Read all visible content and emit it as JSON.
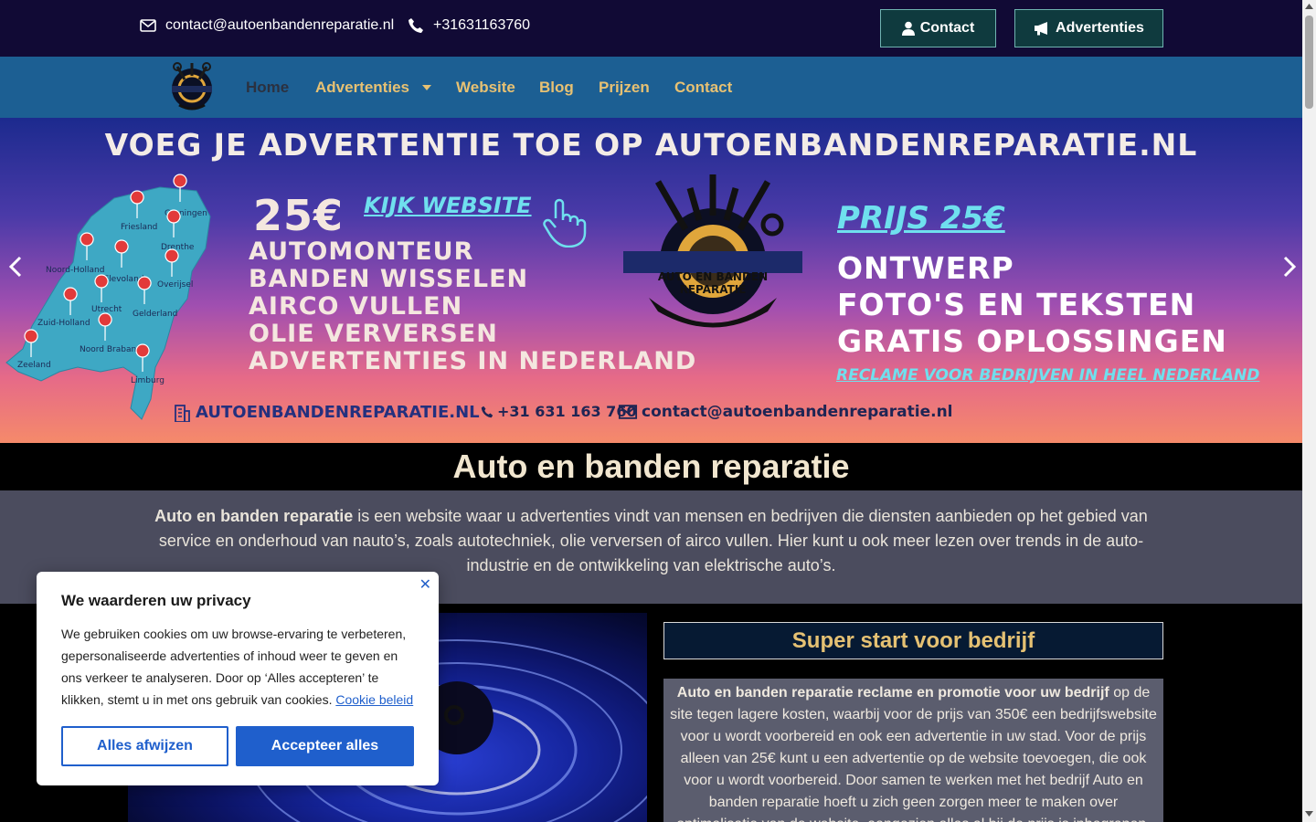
{
  "topbar": {
    "email": "contact@autoenbandenreparatie.nl",
    "phone": "+31631163760",
    "contact_button": "Contact",
    "ads_button": "Advertenties"
  },
  "nav": {
    "items": [
      "Home",
      "Advertenties",
      "Website",
      "Blog",
      "Prijzen",
      "Contact"
    ]
  },
  "hero": {
    "headline": "VOEG JE ADVERTENTIE TOE OP AUTOENBANDENREPARATIE.NL",
    "price_left": "25€",
    "kijk_website": "KIJK WEBSITE",
    "services": [
      "AUTOMONTEUR",
      "BANDEN WISSELEN",
      "AIRCO VULLEN",
      "OLIE VERVERSEN",
      "ADVERTENTIES IN NEDERLAND"
    ],
    "logo_text": "AUTO EN BANDEN REPARATIE",
    "prijs": "PRIJS 25€",
    "offers": [
      "ONTWERP",
      "FOTO'S EN TEKSTEN",
      "GRATIS OPLOSSINGEN"
    ],
    "reclame": "RECLAME VOOR BEDRIJVEN IN HEEL NEDERLAND",
    "bottom_site": "AUTOENBANDENREPARATIE.NL",
    "bottom_phone": "+31 631 163 760",
    "bottom_email": "contact@autoenbandenreparatie.nl",
    "provinces": [
      "Groningen",
      "Friesland",
      "Drenthe",
      "Noord-Holland",
      "Flevoland",
      "Overijsel",
      "Utrecht",
      "Gelderland",
      "Zuid-Holland",
      "Noord Brabant",
      "Zeeland",
      "Limburg"
    ]
  },
  "main": {
    "title": "Auto en banden reparatie",
    "intro_bold": "Auto en banden reparatie",
    "intro_rest": " is een website waar u advertenties vindt van mensen en bedrijven die diensten aanbieden op het gebied van service en onderhoud van nauto’s, zoals autotechniek, olie verversen of airco vullen. Hier kunt u ook meer lezen over trends in de auto-industrie en de ontwikkeling van elektrische auto’s.",
    "super_title": "Super start voor bedrijf",
    "super_bold": "Auto en banden reparatie reclame en promotie voor uw bedrijf",
    "super_rest": " op de site tegen lagere kosten, waarbij voor de prijs van 350€ een bedrijfswebsite voor u wordt voorbereid en ook een advertentie in uw stad. Voor de prijs alleen van 25€ kunt u een advertentie op de website toevoegen, die ook voor u wordt voorbereid. Door samen te werken met het bedrijf Auto en banden reparatie hoeft u zich geen zorgen meer te maken over optimalisatie van de website, aangezien alles al bij de prijs is inbegrepen. Als u echter denkt aan"
  },
  "cookie": {
    "title": "We waarderen uw privacy",
    "body": "We gebruiken cookies om uw browse-ervaring te verbeteren, gepersonaliseerde advertenties of inhoud weer te geven en ons verkeer te analyseren. Door op ‘Alles accepteren’ te klikken, stemt u in met ons gebruik van cookies. ",
    "policy_link": "Cookie beleid",
    "reject": "Alles afwijzen",
    "accept": "Accepteer alles"
  },
  "colors": {
    "topbar_bg": "#110a35",
    "nav_bg": "#1c5f93",
    "nav_text": "#e7c173",
    "accent_blue": "#1f5fcc"
  }
}
